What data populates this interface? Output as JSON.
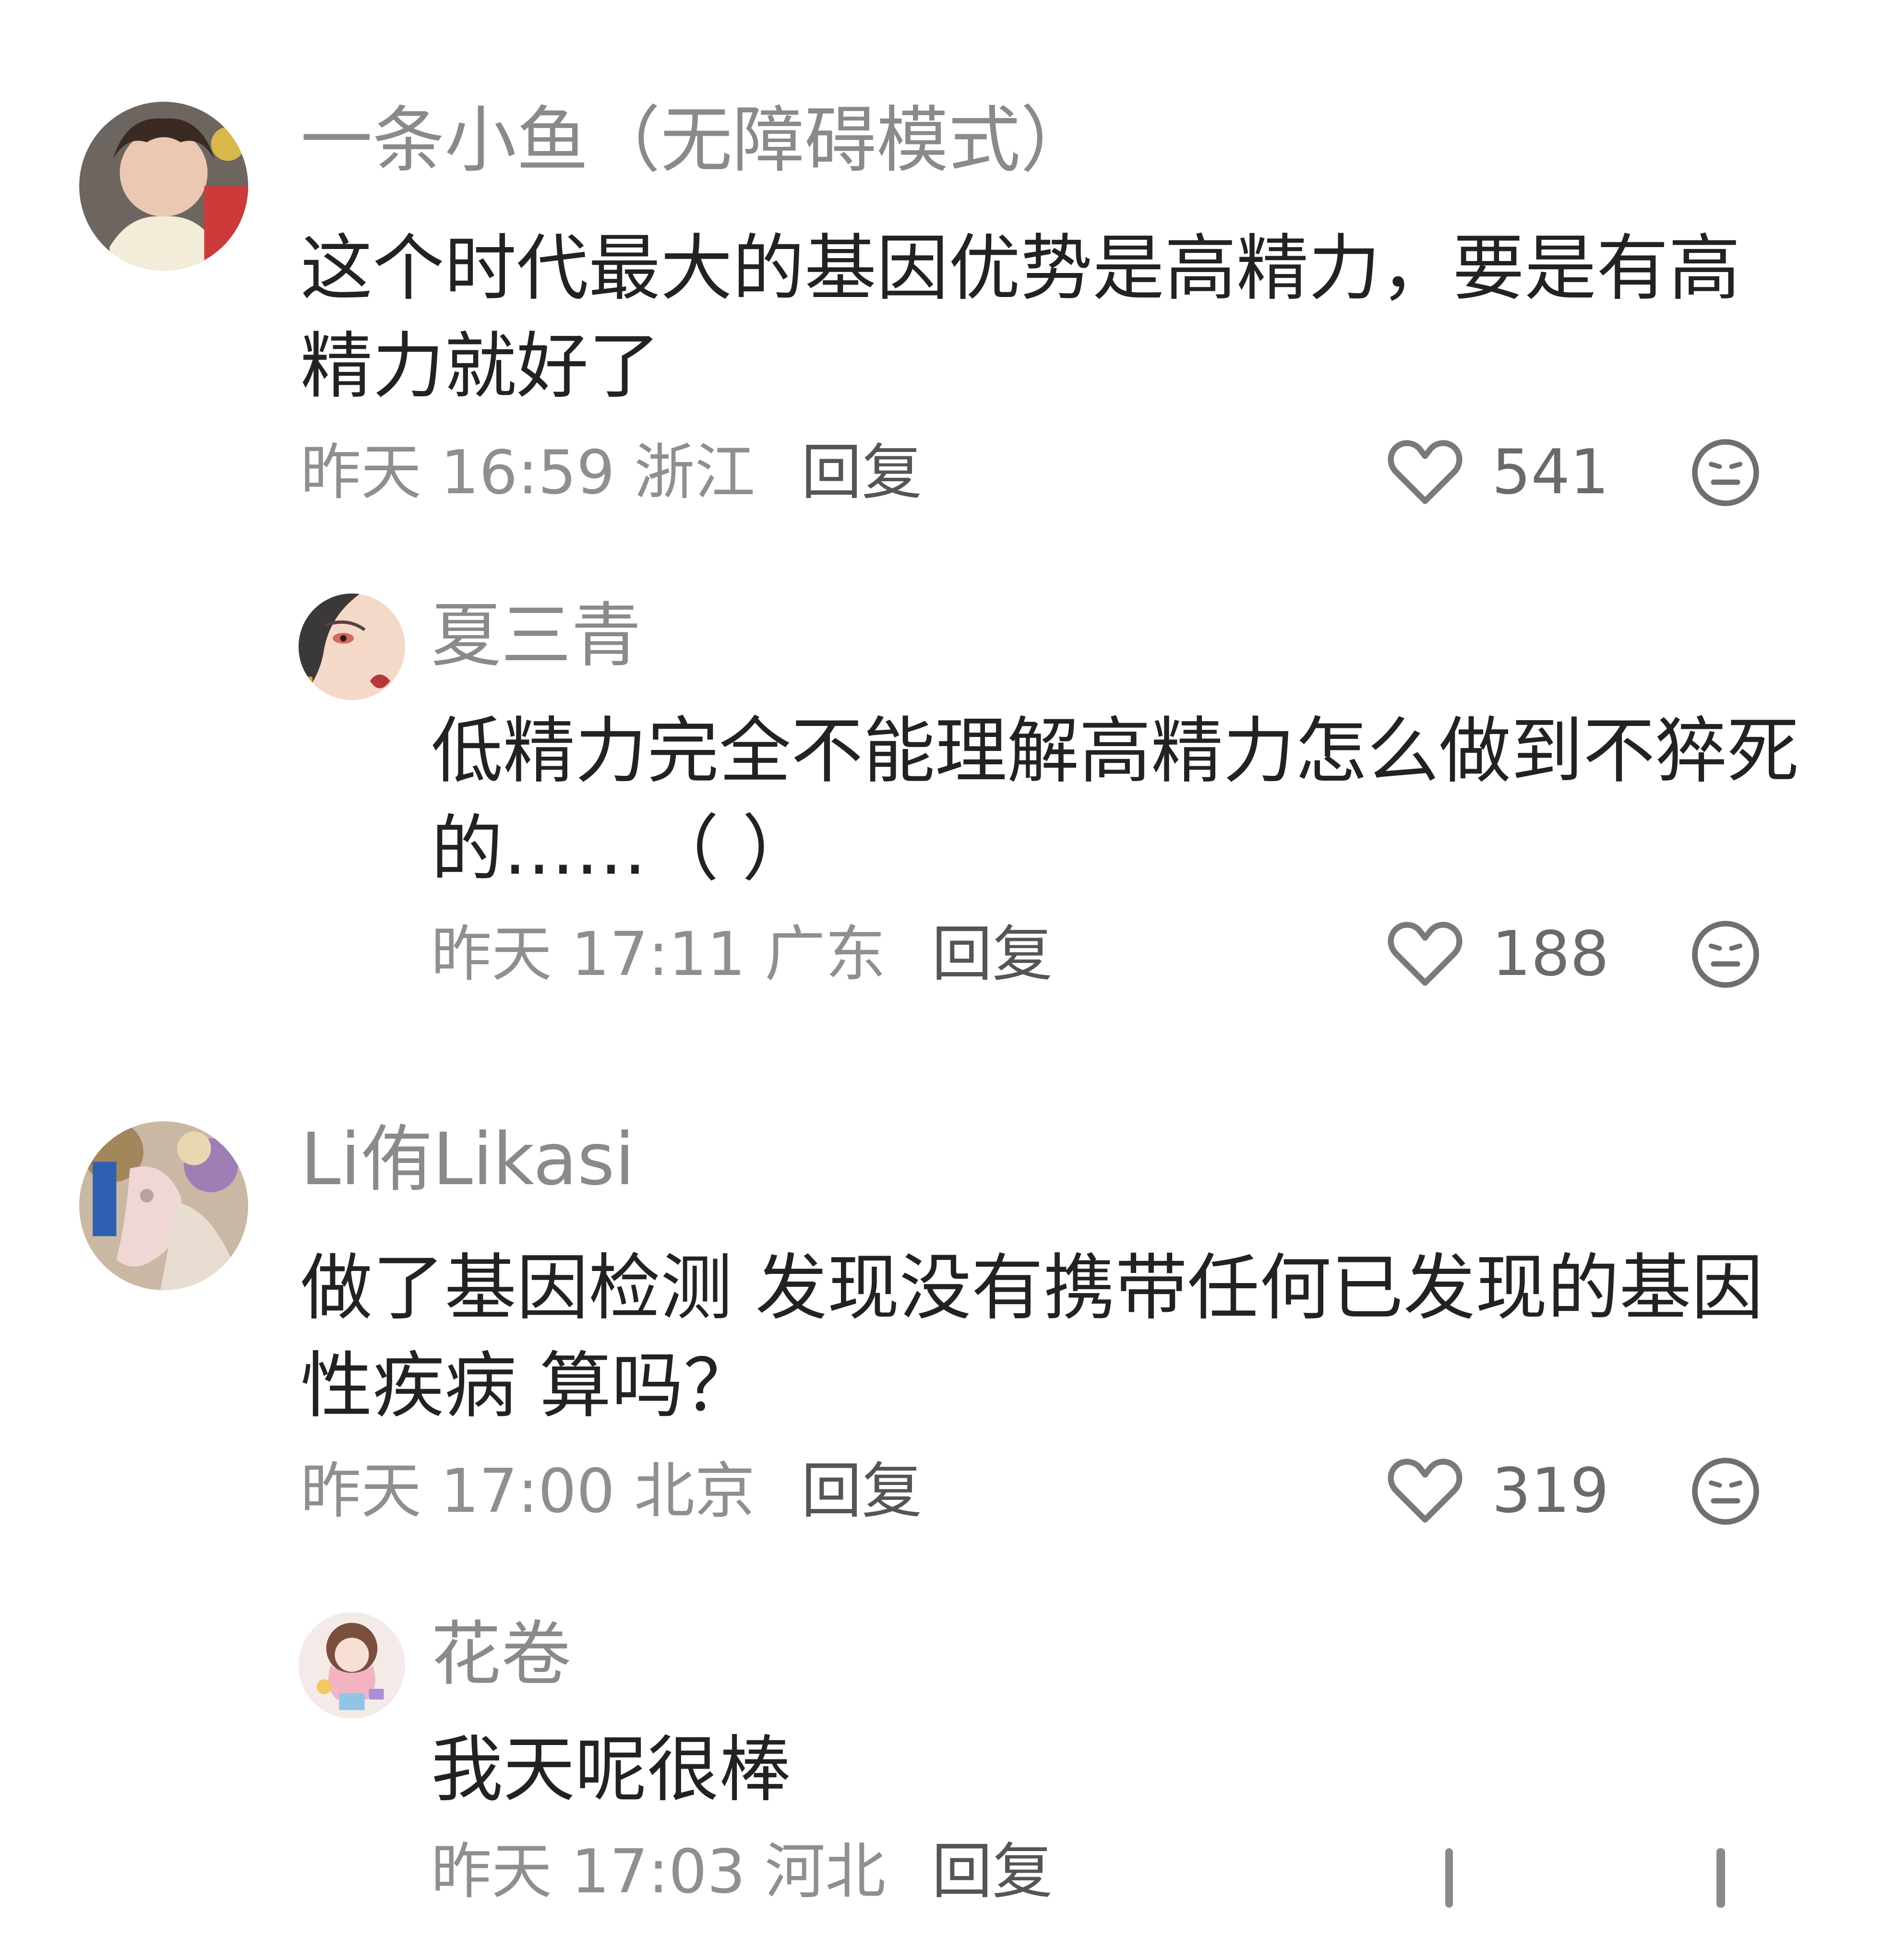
{
  "comments": [
    {
      "username": "一条小鱼（无障碍模式）",
      "text": "这个时代最大的基因优势是高精力，要是有高精力就好了",
      "time": "昨天 16:59",
      "location": "浙江",
      "reply_label": "回复",
      "likes": "541",
      "avatar_icon": "avatar-icon",
      "like_icon": "heart-outline-icon",
      "dislike_icon": "neutral-face-icon"
    },
    {
      "username": "夏三青",
      "text": "低精力完全不能理解高精力怎么做到不猝死的……（ ）",
      "time": "昨天 17:11",
      "location": "广东",
      "reply_label": "回复",
      "likes": "188",
      "avatar_icon": "avatar-icon",
      "like_icon": "heart-outline-icon",
      "dislike_icon": "neutral-face-icon"
    },
    {
      "username": "Li侑Likasi",
      "text": "做了基因检测 发现没有携带任何已发现的基因性疾病 算吗？",
      "time": "昨天 17:00",
      "location": "北京",
      "reply_label": "回复",
      "likes": "319",
      "avatar_icon": "avatar-icon",
      "like_icon": "heart-outline-icon",
      "dislike_icon": "neutral-face-icon"
    },
    {
      "username": "花卷",
      "text": "我天呢很棒",
      "time": "昨天 17:03",
      "location": "河北",
      "reply_label": "回复",
      "avatar_icon": "avatar-icon"
    }
  ],
  "colors": {
    "background": "#ffffff",
    "username": "#8a8a8a",
    "body_text": "#222222",
    "meta_text": "#8f8f8f",
    "icon": "#7a7a7a"
  }
}
